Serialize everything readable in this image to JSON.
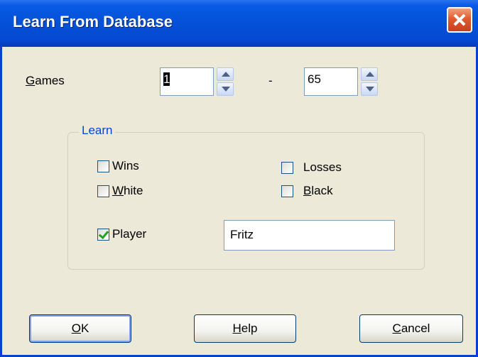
{
  "window": {
    "title": "Learn From Database"
  },
  "games": {
    "label_prefix": "G",
    "label_rest": "ames",
    "from_value": "1",
    "separator": "-",
    "to_value": "65"
  },
  "learn_group": {
    "title": "Learn",
    "wins": {
      "label": "Wins",
      "checked": false
    },
    "losses": {
      "label": "Losses",
      "checked": false
    },
    "white": {
      "label_prefix": "W",
      "label_rest": "hite",
      "checked": false
    },
    "black": {
      "label_prefix": "B",
      "label_rest": "lack",
      "checked": false
    },
    "player": {
      "label": "Player",
      "checked": true,
      "value": "Fritz"
    }
  },
  "buttons": {
    "ok_prefix": "O",
    "ok_rest": "K",
    "help_prefix": "H",
    "help_rest": "elp",
    "cancel_prefix": "C",
    "cancel_rest": "ancel"
  },
  "colors": {
    "titlebar": "#0451d6",
    "dialog_bg": "#ece9d8",
    "group_title": "#0046d5",
    "check": "#21a121"
  }
}
